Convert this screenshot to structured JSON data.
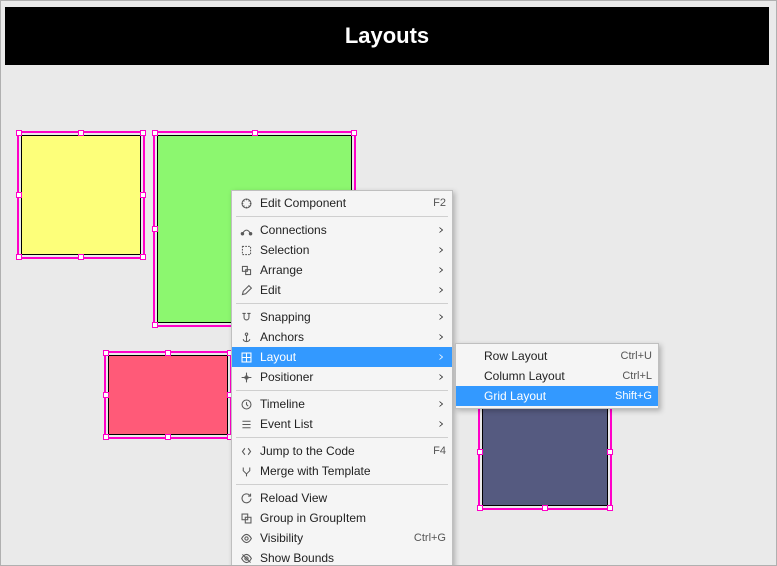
{
  "title": "Layouts",
  "shapes": [
    {
      "name": "yellow-rect",
      "fill": "#fdff7a"
    },
    {
      "name": "green-rect",
      "fill": "#8cf76f"
    },
    {
      "name": "pink-rect",
      "fill": "#ff5a78"
    },
    {
      "name": "purple-rect",
      "fill": "#555a80"
    }
  ],
  "context_menu": {
    "items": [
      {
        "icon": "edit-component-icon",
        "label": "Edit Component",
        "shortcut": "F2",
        "submenu": false
      },
      {
        "sep": true
      },
      {
        "icon": "connections-icon",
        "label": "Connections",
        "shortcut": "",
        "submenu": true
      },
      {
        "icon": "selection-icon",
        "label": "Selection",
        "shortcut": "",
        "submenu": true
      },
      {
        "icon": "arrange-icon",
        "label": "Arrange",
        "shortcut": "",
        "submenu": true
      },
      {
        "icon": "edit-icon",
        "label": "Edit",
        "shortcut": "",
        "submenu": true
      },
      {
        "sep": true
      },
      {
        "icon": "snapping-icon",
        "label": "Snapping",
        "shortcut": "",
        "submenu": true
      },
      {
        "icon": "anchors-icon",
        "label": "Anchors",
        "shortcut": "",
        "submenu": true
      },
      {
        "icon": "layout-icon",
        "label": "Layout",
        "shortcut": "",
        "submenu": true,
        "highlighted": true
      },
      {
        "icon": "positioner-icon",
        "label": "Positioner",
        "shortcut": "",
        "submenu": true
      },
      {
        "sep": true
      },
      {
        "icon": "timeline-icon",
        "label": "Timeline",
        "shortcut": "",
        "submenu": true
      },
      {
        "icon": "event-list-icon",
        "label": "Event List",
        "shortcut": "",
        "submenu": true
      },
      {
        "sep": true
      },
      {
        "icon": "jump-code-icon",
        "label": "Jump to the Code",
        "shortcut": "F4",
        "submenu": false
      },
      {
        "icon": "merge-template-icon",
        "label": "Merge with Template",
        "shortcut": "",
        "submenu": false
      },
      {
        "sep": true
      },
      {
        "icon": "reload-icon",
        "label": "Reload View",
        "shortcut": "",
        "submenu": false
      },
      {
        "icon": "group-icon",
        "label": "Group in GroupItem",
        "shortcut": "",
        "submenu": false
      },
      {
        "icon": "visibility-icon",
        "label": "Visibility",
        "shortcut": "Ctrl+G",
        "submenu": false
      },
      {
        "icon": "bounds-icon",
        "label": "Show Bounds",
        "shortcut": "",
        "submenu": false
      }
    ]
  },
  "submenu": {
    "items": [
      {
        "label": "Row Layout",
        "shortcut": "Ctrl+U",
        "highlighted": false
      },
      {
        "label": "Column Layout",
        "shortcut": "Ctrl+L",
        "highlighted": false
      },
      {
        "label": "Grid Layout",
        "shortcut": "Shift+G",
        "highlighted": true
      }
    ]
  }
}
